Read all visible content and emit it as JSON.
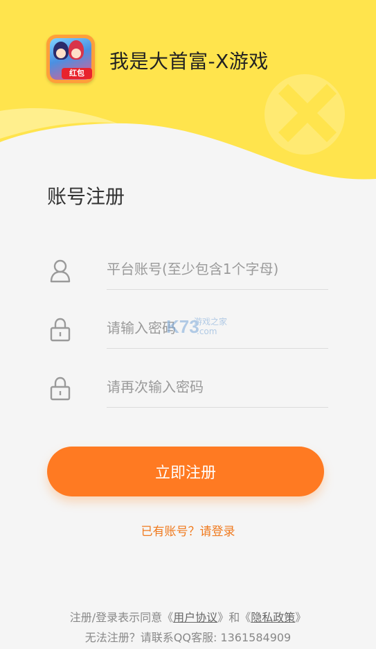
{
  "header": {
    "app_title": "我是大首富-X游戏",
    "app_icon_badge": "红包"
  },
  "page_title": "账号注册",
  "fields": {
    "account_placeholder": "平台账号(至少包含1个字母)",
    "password_placeholder": "请输入密码",
    "confirm_placeholder": "请再次输入密码"
  },
  "watermark": {
    "logo_text": "K73",
    "site_text": "游戏之家",
    "domain_text": ".com"
  },
  "register_button": "立即注册",
  "login_link": "已有账号？请登录",
  "footer": {
    "agree_prefix": "注册/登录表示同意《",
    "user_agreement": "用户协议",
    "middle": "》和《",
    "privacy_policy": "隐私政策",
    "suffix": "》",
    "contact_text": "无法注册？请联系QQ客服: 1361584909"
  },
  "colors": {
    "accent": "#ff7a22",
    "header_yellow": "#ffe44d",
    "link_orange": "#f07a1e"
  }
}
